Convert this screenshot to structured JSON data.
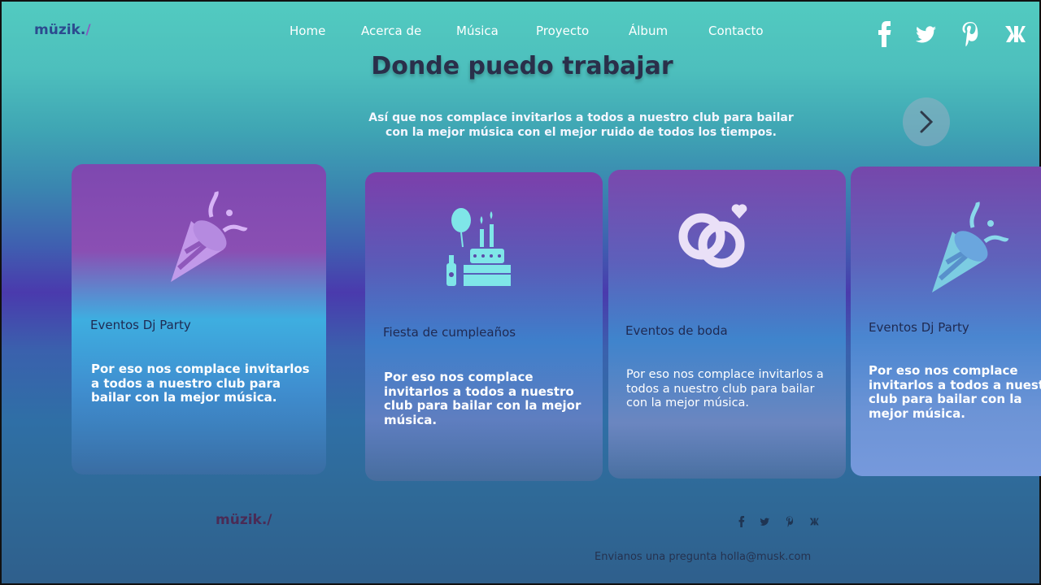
{
  "brand": {
    "logo_text": "müzik.",
    "logo_slash": "/"
  },
  "nav": {
    "items": [
      {
        "label": "Home"
      },
      {
        "label": "Acerca de"
      },
      {
        "label": "Música"
      },
      {
        "label": "Proyecto"
      },
      {
        "label": "Álbum"
      },
      {
        "label": "Contacto"
      }
    ]
  },
  "social": {
    "icons": [
      "facebook-icon",
      "twitter-icon",
      "pinterest-icon",
      "vk-icon"
    ]
  },
  "section": {
    "title": "Donde puedo trabajar",
    "intro_line1": "Así que nos complace invitarlos a todos a nuestro club para bailar",
    "intro_line2": "con la mejor música con el mejor ruido de todos los tiempos."
  },
  "carousel": {
    "next_icon": "chevron-right-icon"
  },
  "cards": [
    {
      "icon": "party-popper-icon",
      "title": "Eventos Dj Party",
      "desc": "Por eso nos complace invitarlos a todos a nuestro club para bailar con la mejor música."
    },
    {
      "icon": "birthday-cake-icon",
      "title": "Fiesta de cumpleaños",
      "desc": "Por eso nos complace invitarlos a todos a nuestro club para bailar con la mejor música."
    },
    {
      "icon": "wedding-rings-icon",
      "title": "Eventos de boda",
      "desc": "Por eso nos complace invitarlos a todos a nuestro club para bailar con la mejor música."
    },
    {
      "icon": "party-popper-icon",
      "title": "Eventos Dj Party",
      "desc": "Por eso nos complace invitarlos a todos a nuestro club para bailar con la mejor música."
    }
  ],
  "footer": {
    "logo_text": "müzik./",
    "contact": "Envianos una pregunta holla@musk.com"
  },
  "colors": {
    "title": "#2a2f4a",
    "nav_text": "#ffffff",
    "logo": "#2c4b8f"
  }
}
